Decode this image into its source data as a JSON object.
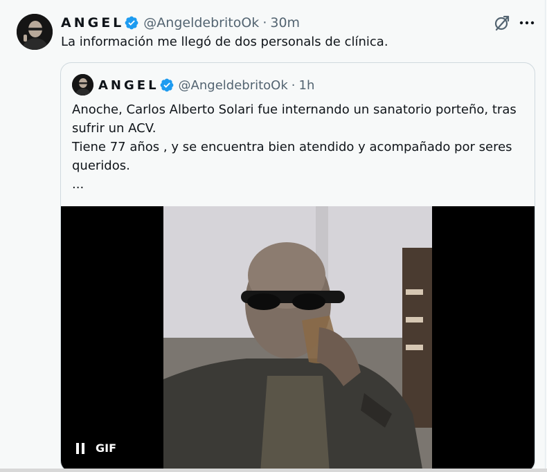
{
  "tweet": {
    "author_name": "ANGEL",
    "handle": "@AngeldebritoOk",
    "separator": "·",
    "time": "30m",
    "text": "La información me llegó de dos personals de clínica."
  },
  "quoted_tweet": {
    "author_name": "ANGEL",
    "handle": "@AngeldebritoOk",
    "separator": "·",
    "time": "1h",
    "text_lines": [
      "Anoche, Carlos Alberto Solari fue internando un sanatorio porteño, tras sufrir un ACV.",
      "Tiene 77 años , y se encuentra bien atendido y acompañado por seres queridos.",
      "..."
    ],
    "media": {
      "type": "gif",
      "badge": "GIF"
    }
  },
  "colors": {
    "verified": "#1d9bf0",
    "secondary_text": "#536471",
    "background": "#f7f9f9",
    "border": "#cfd9de"
  },
  "icons": [
    "verified-badge-icon",
    "grok-icon",
    "more-options-icon",
    "pause-icon"
  ]
}
